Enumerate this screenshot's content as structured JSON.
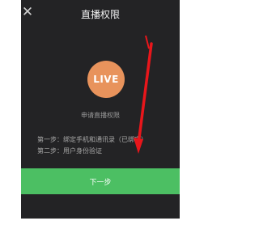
{
  "header": {
    "close_icon": "close-icon",
    "title": "直播权限"
  },
  "badge": {
    "text": "LIVE",
    "color": "#e8935c"
  },
  "content": {
    "apply_label": "申请直播权限",
    "step1": "第一步：绑定手机和通讯录（已绑定）",
    "step2": "第二步：用户身份验证"
  },
  "actions": {
    "next_label": "下一步",
    "accent": "#4cbf63"
  },
  "annotation": {
    "arrow_color": "#e8161b"
  }
}
